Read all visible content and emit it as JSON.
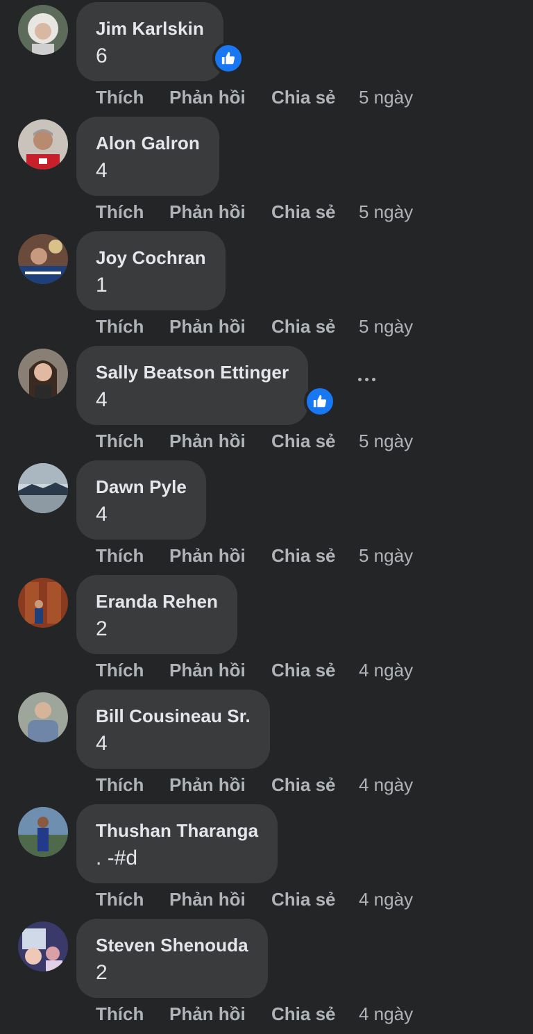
{
  "labels": {
    "like": "Thích",
    "reply": "Phản hồi",
    "share": "Chia sẻ"
  },
  "comments": [
    {
      "name": "Jim Karlskin",
      "text": "6",
      "time": "5 ngày",
      "liked": true
    },
    {
      "name": "Alon Galron",
      "text": "4",
      "time": "5 ngày",
      "liked": false
    },
    {
      "name": "Joy Cochran",
      "text": "1",
      "time": "5 ngày",
      "liked": false
    },
    {
      "name": "Sally Beatson Ettinger",
      "text": "4",
      "time": "5 ngày",
      "liked": true,
      "more_menu": true
    },
    {
      "name": "Dawn Pyle",
      "text": "4",
      "time": "5 ngày",
      "liked": false
    },
    {
      "name": "Eranda Rehen",
      "text": "2",
      "time": "4 ngày",
      "liked": false
    },
    {
      "name": "Bill Cousineau Sr.",
      "text": "4",
      "time": "4 ngày",
      "liked": false
    },
    {
      "name": "Thushan Tharanga",
      "text": ". -#d",
      "time": "4 ngày",
      "liked": false
    },
    {
      "name": "Steven Shenouda",
      "text": "2",
      "time": "4 ngày",
      "liked": false
    }
  ],
  "colors": {
    "background": "#242526",
    "bubble": "#3a3b3c",
    "text": "#e4e6eb",
    "secondary": "#b0b3b8",
    "like_blue": "#1877f2"
  },
  "icons": {
    "like_badge": "thumbs-up-icon",
    "more": "more-horizontal-icon"
  }
}
